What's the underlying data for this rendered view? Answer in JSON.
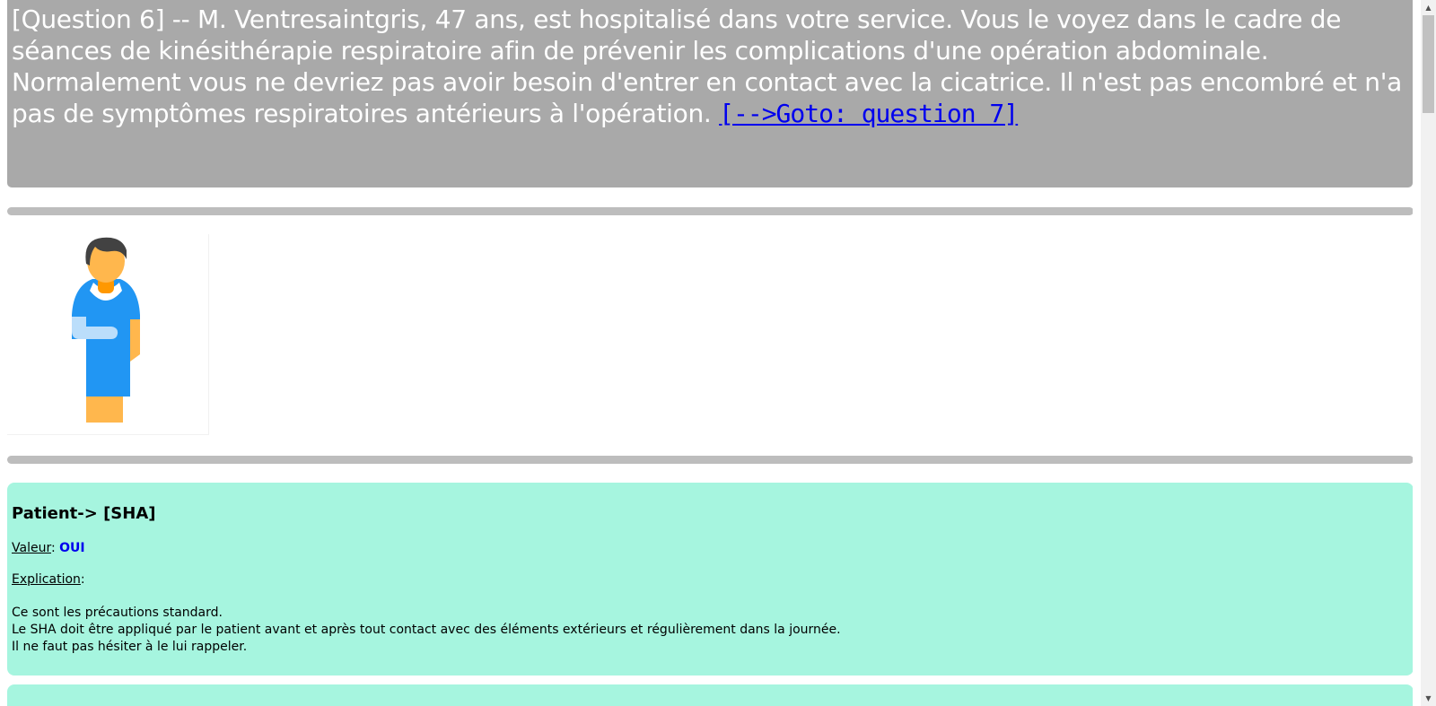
{
  "question": {
    "text": "[Question 6] -- M. Ventresaintgris, 47 ans, est hospitalisé dans votre service. Vous le voyez dans le cadre de séances de kinésithérapie respiratoire afin de prévenir les complications d'une opération abdominale. Normalement vous ne devriez pas avoir besoin d'entrer en contact avec la cicatrice. Il n'est pas encombré et n'a pas de symptômes respiratoires antérieurs à l'opération.",
    "goto_link": "[-->Goto: question 7]"
  },
  "figure": {
    "icon": "patient-figure-icon"
  },
  "answer": {
    "title": "Patient-> [SHA]",
    "valeur_label": "Valeur",
    "valeur_value": "OUI",
    "explication_label": "Explication",
    "explication_lines": [
      "Ce sont les précautions standard.",
      "Le SHA doit être appliqué par le patient avant et après tout contact avec des éléments extérieurs et régulièrement dans la journée.",
      "Il ne faut pas hésiter à le lui rappeler."
    ]
  },
  "colors": {
    "question_bg": "#a9a9a9",
    "answer_bg": "#a6f5df",
    "link": "#0000ee",
    "divider": "#bdbdbd"
  }
}
